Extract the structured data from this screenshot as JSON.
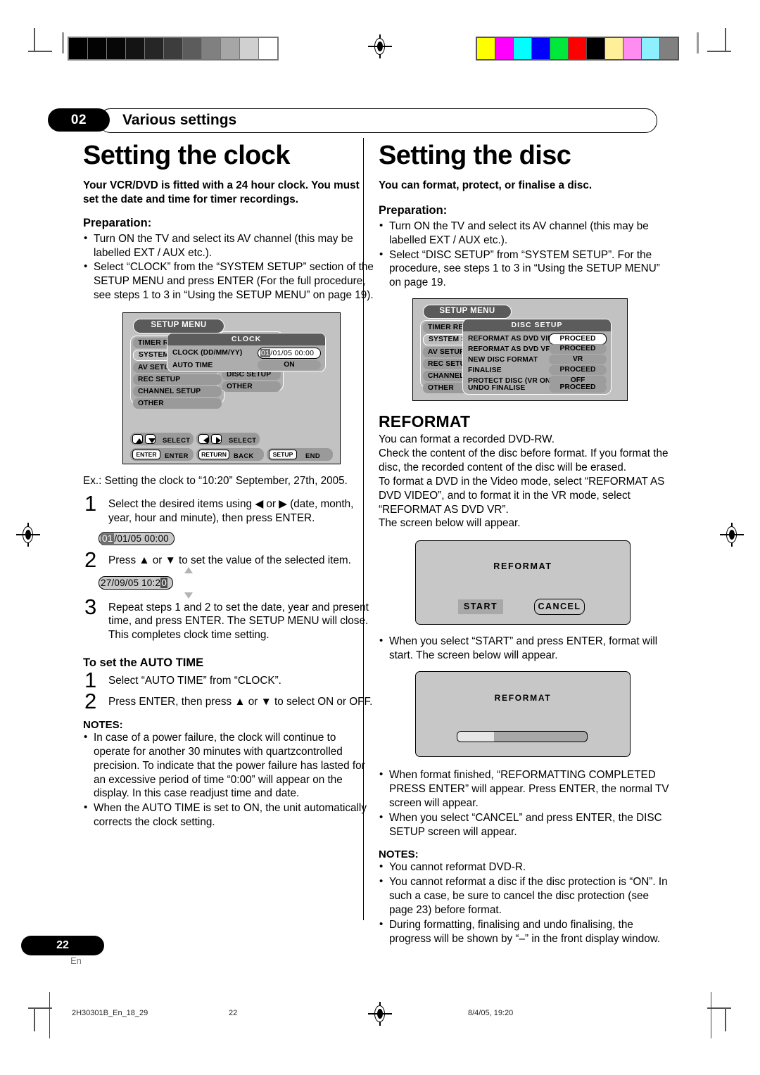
{
  "header": {
    "chapter_number": "02",
    "chapter_title": "Various settings"
  },
  "left": {
    "title": "Setting the clock",
    "lead": "Your VCR/DVD is fitted with a 24 hour clock. You must set the date and time for timer recordings.",
    "preparation_label": "Preparation:",
    "preparation": [
      "Turn ON the TV and select its AV channel (this may be labelled EXT / AUX etc.).",
      "Select “CLOCK” from the “SYSTEM SETUP” section of the SETUP MENU and press ENTER (For the full procedure, see steps 1 to 3 in “Using the SETUP MENU” on page 19)."
    ],
    "example": "Ex.: Setting the clock to “10:20” September, 27th, 2005.",
    "steps": [
      {
        "num": "1",
        "text": "Select the desired items using ◀ or ▶ (date, month, year, hour and minute), then press ENTER."
      },
      {
        "num": "2",
        "text": "Press ▲ or ▼ to set the value of the selected item."
      },
      {
        "num": "3",
        "text": "Repeat steps 1 and 2 to set the date, year and present time, and press ENTER. The SETUP MENU will close. This completes clock time setting."
      }
    ],
    "pill_step1": {
      "highlight": "01",
      "rest": "/01/05 00:00"
    },
    "pill_step2": {
      "prefix": "27/09/05 10:2",
      "highlight": "0"
    },
    "autotime_heading": "To set the AUTO TIME",
    "autotime_steps": [
      {
        "num": "1",
        "text": "Select “AUTO TIME” from “CLOCK”."
      },
      {
        "num": "2",
        "text": "Press ENTER, then press ▲ or ▼ to select ON or OFF."
      }
    ],
    "notes_label": "NOTES:",
    "notes": [
      "In case of a power failure, the clock will continue  to operate for another 30 minutes with quartzcontrolled precision. To indicate that the power failure has lasted for an excessive period of time “0:00” will appear on the display. In this case readjust time and date.",
      "When the AUTO TIME is set to ON, the unit automatically corrects the clock setting."
    ]
  },
  "clock_osd": {
    "menu_tag": "SETUP MENU",
    "left_items": [
      "TIMER REC S",
      "SYSTEM SET",
      "AV SETUP",
      "REC SETUP",
      "CHANNEL SETUP",
      "OTHER"
    ],
    "selected_left_item": "SYSTEM SET",
    "right_items": [
      "DISC SETUP",
      "OTHER"
    ],
    "overlay_title": "CLOCK",
    "overlay_rows": [
      {
        "label": "CLOCK (DD/MM/YY)",
        "value_highlight": "01",
        "value_rest": "/01/05 00:00",
        "boxed": true
      },
      {
        "label": "AUTO TIME",
        "value": "ON",
        "boxed": false
      }
    ],
    "guide": [
      {
        "icons": [
          "up-arrow",
          "down-arrow"
        ],
        "text": "SELECT"
      },
      {
        "icons": [
          "left-arrow",
          "right-arrow"
        ],
        "text": "SELECT"
      },
      {
        "key": "ENTER",
        "text": "ENTER"
      },
      {
        "key": "RETURN",
        "text": "BACK"
      },
      {
        "key": "SETUP",
        "text": "END"
      }
    ]
  },
  "right": {
    "title": "Setting the disc",
    "lead": "You can format, protect, or finalise a disc.",
    "preparation_label": "Preparation:",
    "preparation": [
      "Turn ON the TV and select its AV channel (this may be labelled EXT / AUX etc.).",
      "Select “DISC SETUP” from “SYSTEM SETUP”. For the procedure, see steps 1 to 3 in “Using the SETUP MENU” on page 19."
    ],
    "section_heading": "REFORMAT",
    "body": "You can format a recorded DVD-RW.\nCheck the content of the disc before format. If you format the disc, the recorded content of the disc will be erased.\nTo format a DVD in the Video mode, select “REFORMAT AS DVD VIDEO”, and to format it in the VR mode, select “REFORMAT AS DVD VR”.\nThe screen below will appear.",
    "bullets_mid": [
      "When you select “START” and press ENTER, format will start. The screen below will appear."
    ],
    "bullets_end": [
      "When format finished, “REFORMATTING COMPLETED PRESS ENTER” will appear. Press ENTER, the normal TV screen will appear.",
      "When you select “CANCEL” and press ENTER, the DISC SETUP screen will appear."
    ],
    "notes_label": "NOTES:",
    "notes": [
      "You cannot reformat DVD-R.",
      "You cannot reformat a disc if the disc protection is “ON”. In such a case, be sure to cancel the disc protection (see page 23) before format.",
      "During formatting, finalising and undo finalising, the progress will be shown by “–” in the front display window."
    ]
  },
  "disc_osd": {
    "menu_tag": "SETUP MENU",
    "left_items": [
      "TIMER REC S",
      "SYSTEM SET",
      "AV SETUP",
      "REC SETUP",
      "CHANNEL SE",
      "OTHER"
    ],
    "selected_left_item": "SYSTEM SET",
    "overlay_title": "DISC SETUP",
    "overlay_rows": [
      {
        "label": "REFORMAT AS DVD VIDEO",
        "value": "PROCEED",
        "highlighted": true
      },
      {
        "label": "REFORMAT AS DVD VR",
        "value": "PROCEED",
        "highlighted": false
      },
      {
        "label": "NEW DISC FORMAT",
        "value": "VR",
        "highlighted": false
      },
      {
        "label": "FINALISE",
        "value": "PROCEED",
        "highlighted": false
      },
      {
        "label": "PROTECT DISC (VR ONLY)",
        "value": "OFF",
        "highlighted": false
      },
      {
        "label": "UNDO FINALISE",
        "value": "PROCEED",
        "highlighted": false
      }
    ]
  },
  "reformat_dialog": {
    "title": "REFORMAT",
    "start_label": "START",
    "cancel_label": "CANCEL"
  },
  "reformat_progress": {
    "title": "REFORMAT",
    "progress_percent": 28
  },
  "footer": {
    "page_number": "22",
    "language": "En",
    "file_name": "2H30301B_En_18_29",
    "folio": "22",
    "timestamp": "8/4/05, 19:20"
  },
  "registration": {
    "grey_steps": [
      "#000000",
      "#030303",
      "#070707",
      "#141414",
      "#262626",
      "#3d3d3d",
      "#5c5c5c",
      "#808080",
      "#a6a6a6",
      "#d0d0d0",
      "#ffffff"
    ],
    "color_steps": [
      "#ffff00",
      "#ff00ff",
      "#00ffff",
      "#0000ff",
      "#00e83c",
      "#ff0000",
      "#000000",
      "#ffef99",
      "#ff8cf0",
      "#8cf0ff",
      "#808080"
    ]
  }
}
